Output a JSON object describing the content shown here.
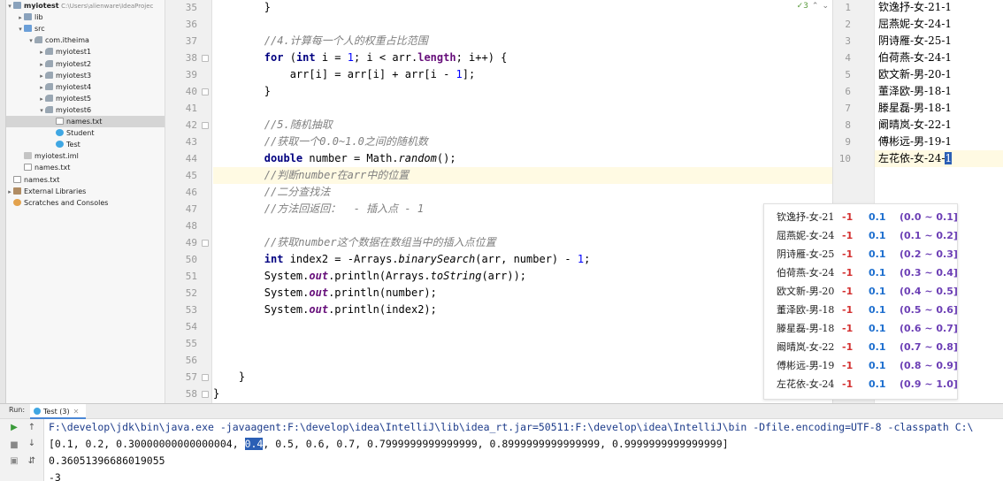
{
  "project": {
    "root_name": "myiotest",
    "root_path": "C:\\Users\\alienware\\IdeaProjec",
    "items": [
      {
        "label": "lib",
        "depth": 1,
        "arrow": "▸",
        "icon": "folder"
      },
      {
        "label": "src",
        "depth": 1,
        "arrow": "▾",
        "icon": "blue-folder"
      },
      {
        "label": "com.itheima",
        "depth": 2,
        "arrow": "▾",
        "icon": "pkg"
      },
      {
        "label": "myiotest1",
        "depth": 3,
        "arrow": "▸",
        "icon": "pkg"
      },
      {
        "label": "myiotest2",
        "depth": 3,
        "arrow": "▸",
        "icon": "pkg"
      },
      {
        "label": "myiotest3",
        "depth": 3,
        "arrow": "▸",
        "icon": "pkg"
      },
      {
        "label": "myiotest4",
        "depth": 3,
        "arrow": "▸",
        "icon": "pkg"
      },
      {
        "label": "myiotest5",
        "depth": 3,
        "arrow": "▸",
        "icon": "pkg"
      },
      {
        "label": "myiotest6",
        "depth": 3,
        "arrow": "▾",
        "icon": "pkg"
      },
      {
        "label": "names.txt",
        "depth": 4,
        "arrow": "",
        "icon": "file",
        "selected": true
      },
      {
        "label": "Student",
        "depth": 4,
        "arrow": "",
        "icon": "cls"
      },
      {
        "label": "Test",
        "depth": 4,
        "arrow": "",
        "icon": "cls"
      },
      {
        "label": "myiotest.iml",
        "depth": 1,
        "arrow": "",
        "icon": "iml"
      },
      {
        "label": "names.txt",
        "depth": 1,
        "arrow": "",
        "icon": "file"
      },
      {
        "label": "names.txt",
        "depth": 0,
        "arrow": "",
        "icon": "file"
      },
      {
        "label": "External Libraries",
        "depth": 0,
        "arrow": "▸",
        "icon": "lib"
      },
      {
        "label": "Scratches and Consoles",
        "depth": 0,
        "arrow": "",
        "icon": "scratch"
      }
    ]
  },
  "editor": {
    "inspection_count": "3",
    "line_numbers": [
      "35",
      "36",
      "37",
      "38",
      "39",
      "40",
      "41",
      "42",
      "43",
      "44",
      "45",
      "46",
      "47",
      "48",
      "49",
      "50",
      "51",
      "52",
      "53",
      "54",
      "55",
      "56",
      "57",
      "58"
    ],
    "lines": [
      {
        "text": "        }",
        "type": "plain"
      },
      {
        "text": "",
        "type": "plain"
      },
      {
        "text": "        //4.计算每一个人的权重占比范围",
        "type": "comment"
      },
      {
        "text": "",
        "type": "for"
      },
      {
        "text": "",
        "type": "arr"
      },
      {
        "text": "        }",
        "type": "plain"
      },
      {
        "text": "",
        "type": "plain"
      },
      {
        "text": "        //5.随机抽取",
        "type": "comment"
      },
      {
        "text": "        //获取一个0.0~1.0之间的随机数",
        "type": "comment"
      },
      {
        "text": "",
        "type": "double"
      },
      {
        "text": "        //判断number在arr中的位置",
        "type": "comment",
        "highlight": true
      },
      {
        "text": "        //二分查找法",
        "type": "comment"
      },
      {
        "text": "        //方法回返回：  - 插入点 - 1",
        "type": "comment"
      },
      {
        "text": "",
        "type": "plain"
      },
      {
        "text": "        //获取number这个数据在数组当中的插入点位置",
        "type": "comment"
      },
      {
        "text": "",
        "type": "index2"
      },
      {
        "text": "",
        "type": "println_arr"
      },
      {
        "text": "",
        "type": "println_number"
      },
      {
        "text": "",
        "type": "println_index2"
      },
      {
        "text": "",
        "type": "plain"
      },
      {
        "text": "",
        "type": "plain"
      },
      {
        "text": "",
        "type": "plain"
      },
      {
        "text": "    }",
        "type": "plain"
      },
      {
        "text": "}",
        "type": "plain"
      }
    ]
  },
  "names_file": {
    "line_numbers": [
      "1",
      "2",
      "3",
      "4",
      "5",
      "6",
      "7",
      "8",
      "9",
      "10"
    ],
    "lines": [
      "钦逸抒-女-21-1",
      "屈燕妮-女-24-1",
      "阴诗雁-女-25-1",
      "伯荷燕-女-24-1",
      "欧文新-男-20-1",
      "董泽欧-男-18-1",
      "滕星磊-男-18-1",
      "阚晴岚-女-22-1",
      "傅彬远-男-19-1",
      "左花依-女-24-"
    ],
    "last_line_selected": "1"
  },
  "overlay": {
    "rows": [
      {
        "name": "钦逸抒-女-21",
        "neg": "-1",
        "step": "0.1",
        "range": "(0.0 ~ 0.1]"
      },
      {
        "name": "屈燕妮-女-24",
        "neg": "-1",
        "step": "0.1",
        "range": "(0.1 ~ 0.2]"
      },
      {
        "name": "阴诗雁-女-25",
        "neg": "-1",
        "step": "0.1",
        "range": "(0.2 ~ 0.3]"
      },
      {
        "name": "伯荷燕-女-24",
        "neg": "-1",
        "step": "0.1",
        "range": "(0.3 ~ 0.4]"
      },
      {
        "name": "欧文新-男-20",
        "neg": "-1",
        "step": "0.1",
        "range": "(0.4 ~ 0.5]"
      },
      {
        "name": "董泽欧-男-18",
        "neg": "-1",
        "step": "0.1",
        "range": "(0.5 ~ 0.6]"
      },
      {
        "name": "滕星磊-男-18",
        "neg": "-1",
        "step": "0.1",
        "range": "(0.6 ~ 0.7]"
      },
      {
        "name": "阚晴岚-女-22",
        "neg": "-1",
        "step": "0.1",
        "range": "(0.7 ~ 0.8]"
      },
      {
        "name": "傅彬远-男-19",
        "neg": "-1",
        "step": "0.1",
        "range": "(0.8 ~ 0.9]"
      },
      {
        "name": "左花依-女-24",
        "neg": "-1",
        "step": "0.1",
        "range": "(0.9 ~ 1.0]"
      }
    ]
  },
  "run": {
    "label": "Run:",
    "tab_label": "Test (3)",
    "command": "F:\\develop\\jdk\\bin\\java.exe -javaagent:F:\\develop\\idea\\IntelliJ\\lib\\idea_rt.jar=50511:F:\\develop\\idea\\IntelliJ\\bin -Dfile.encoding=UTF-8 -classpath C:\\",
    "output_arr_pre": "[0.1, 0.2, 0.30000000000000004, ",
    "output_arr_sel": "0.4",
    "output_arr_post": ", 0.5, 0.6, 0.7, 0.7999999999999999, 0.8999999999999999, 0.9999999999999999]",
    "output_number": "0.36051396686019055",
    "output_index": "-3"
  },
  "colors": {
    "keyword": "#000080",
    "comment": "#808080",
    "number": "#0000ff",
    "field": "#660e7a",
    "selection": "#2b5fb5",
    "current_line": "#fffae3"
  }
}
